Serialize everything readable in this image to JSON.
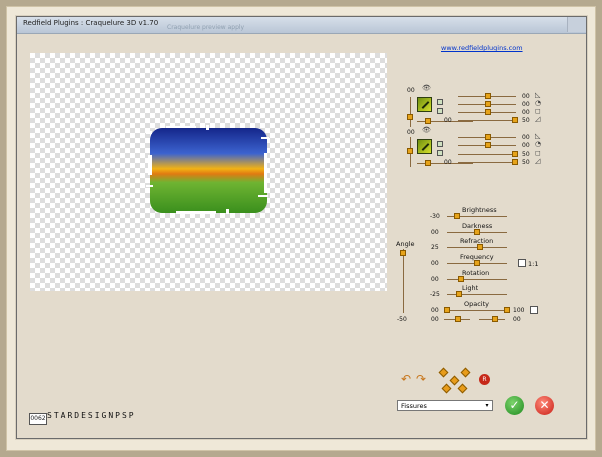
{
  "window": {
    "title": "Redfield Plugins : Craquelure 3D  v1.70",
    "ghost_text": "Craquelure   preview   apply"
  },
  "header": {
    "link_text": "www.redfieldplugins.com"
  },
  "footer": {
    "counter": "0062",
    "logo_text": "STARDESIGNPSP"
  },
  "texture_group_1": {
    "left_value": "00",
    "bottom_value": "00",
    "rows": [
      {
        "value": "00",
        "shape_icon": "triangle-icon",
        "level": 0.56
      },
      {
        "value": "00",
        "shape_icon": "circle-quarter-icon",
        "level": 0.52
      },
      {
        "value": "00",
        "shape_icon": "square-icon",
        "level": 0.52
      },
      {
        "value": "50",
        "shape_icon": "cone-icon",
        "level": 1.0
      }
    ]
  },
  "texture_group_2": {
    "left_value": "00",
    "bottom_value": "00",
    "rows": [
      {
        "value": "00",
        "shape_icon": "triangle-icon",
        "level": 0.52
      },
      {
        "value": "00",
        "shape_icon": "circle-quarter-icon",
        "level": 0.52
      },
      {
        "value": "50",
        "shape_icon": "square-icon",
        "level": 0.98
      },
      {
        "value": "50",
        "shape_icon": "cone-icon",
        "level": 0.98
      }
    ]
  },
  "angle": {
    "label": "Angle",
    "value": "-50"
  },
  "sliders": [
    {
      "label": "Brightness",
      "value": "-30",
      "level": 0.17
    },
    {
      "label": "Darkness",
      "value": "00",
      "level": 0.5
    },
    {
      "label": "Refraction",
      "value": "25",
      "level": 0.56
    },
    {
      "label": "Frequency",
      "value": "00",
      "level": 0.5
    },
    {
      "label": "Rotation",
      "value": "00",
      "level": 0.24
    },
    {
      "label": "Light",
      "value": "-25",
      "level": 0.2
    }
  ],
  "frequency_toggle": {
    "label": "1:1"
  },
  "opacity": {
    "label": "Opacity",
    "left_value": "00",
    "right_value": "100",
    "row2_left": "00",
    "row2_right": "00"
  },
  "controls": {
    "dropdown_value": "Fissures"
  },
  "colors": {
    "accent": "#e6a31a",
    "ok": "#1f8a1f",
    "cancel": "#c81d14",
    "link": "#0033cc"
  }
}
